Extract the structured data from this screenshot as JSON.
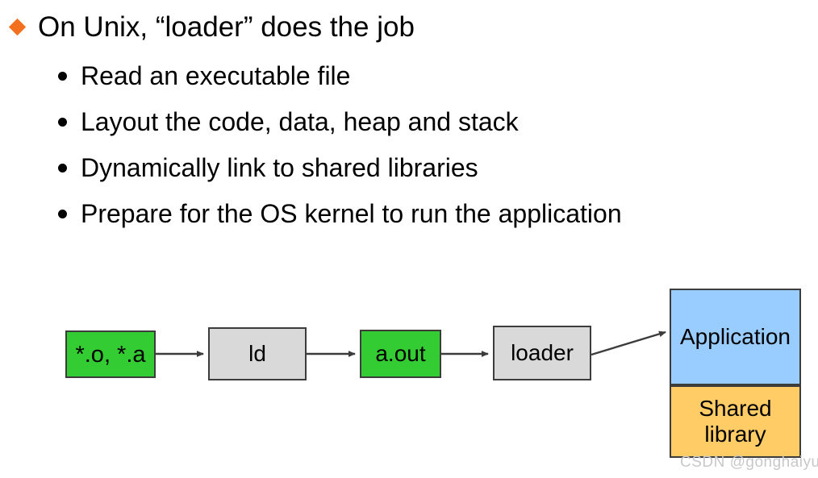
{
  "slide": {
    "main_bullet": {
      "marker": "diamond-bullet",
      "text": "On Unix, “loader” does the job"
    },
    "sub_bullets": [
      {
        "marker": "round-bullet",
        "text": "Read an executable file"
      },
      {
        "marker": "round-bullet",
        "text": "Layout the code, data, heap and stack"
      },
      {
        "marker": "round-bullet",
        "text": "Dynamically link to shared libraries"
      },
      {
        "marker": "round-bullet",
        "text": "Prepare for the OS kernel to run the application"
      }
    ]
  },
  "diagram": {
    "type": "flowchart",
    "nodes": [
      {
        "id": "obj",
        "label": "*.o, *.a",
        "color": "#33CC33"
      },
      {
        "id": "ld",
        "label": "ld",
        "color": "#D9D9D9"
      },
      {
        "id": "aout",
        "label": "a.out",
        "color": "#33CC33"
      },
      {
        "id": "loader",
        "label": "loader",
        "color": "#D9D9D9"
      },
      {
        "id": "app",
        "label": "Application",
        "color": "#99CCFF"
      },
      {
        "id": "shared",
        "label_line1": "Shared",
        "label_line2": "library",
        "color": "#FFCC66"
      }
    ],
    "edges": [
      {
        "from": "obj",
        "to": "ld"
      },
      {
        "from": "ld",
        "to": "aout"
      },
      {
        "from": "aout",
        "to": "loader"
      },
      {
        "from": "loader",
        "to": "app"
      }
    ]
  },
  "watermark": {
    "text": "CSDN @gonghaiyu",
    "color": "#C8C8C8"
  },
  "colors": {
    "bullet_accent": "#F4701E",
    "green": "#33CC33",
    "gray": "#D9D9D9",
    "blue": "#99CCFF",
    "orange": "#FFCC66",
    "border": "#3C3C3C",
    "arrow": "#3C3C3C"
  }
}
